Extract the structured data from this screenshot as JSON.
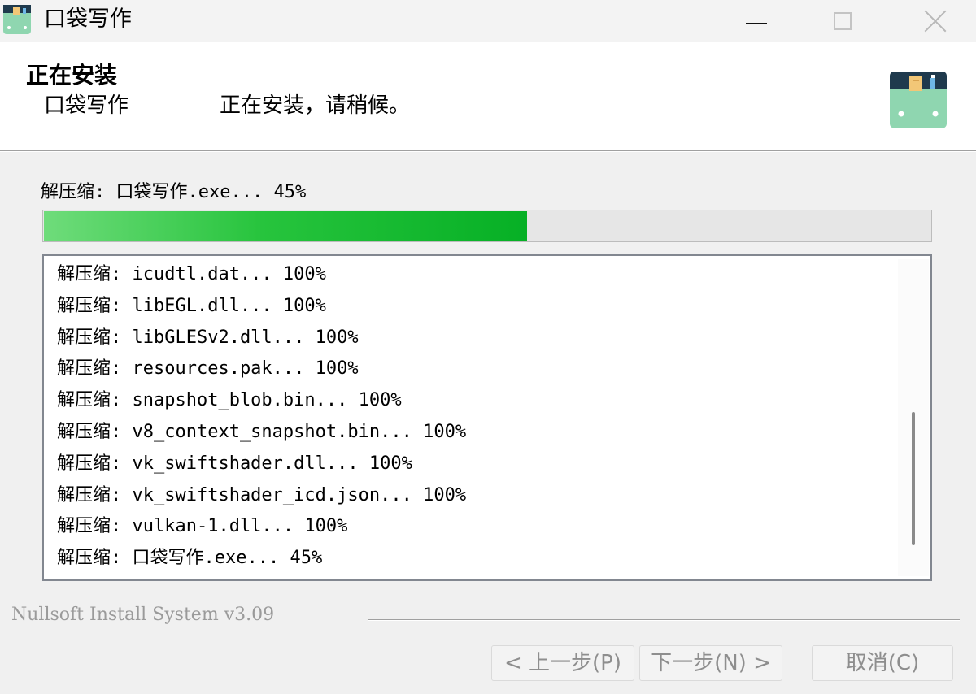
{
  "window": {
    "title": "口袋写作",
    "icon": "app-icon"
  },
  "header": {
    "title": "正在安装",
    "app_name": "口袋写作",
    "subtitle": "正在安装，请稍候。",
    "logo": "app-logo-icon"
  },
  "status": {
    "text": "解压缩: 口袋写作.exe... 45%",
    "progress_percent": 45
  },
  "log": {
    "items": [
      "解压缩: icudtl.dat... 100%",
      "解压缩: libEGL.dll... 100%",
      "解压缩: libGLESv2.dll... 100%",
      "解压缩: resources.pak... 100%",
      "解压缩: snapshot_blob.bin... 100%",
      "解压缩: v8_context_snapshot.bin... 100%",
      "解压缩: vk_swiftshader.dll... 100%",
      "解压缩: vk_swiftshader_icd.json... 100%",
      "解压缩: vulkan-1.dll... 100%",
      "解压缩: 口袋写作.exe... 45%"
    ]
  },
  "branding": "Nullsoft Install System v3.09",
  "buttons": {
    "back": "< 上一步(P)",
    "next": "下一步(N) >",
    "cancel": "取消(C)"
  },
  "colors": {
    "progress_fill": "#06b025",
    "disabled_text": "#8e8e8e"
  }
}
